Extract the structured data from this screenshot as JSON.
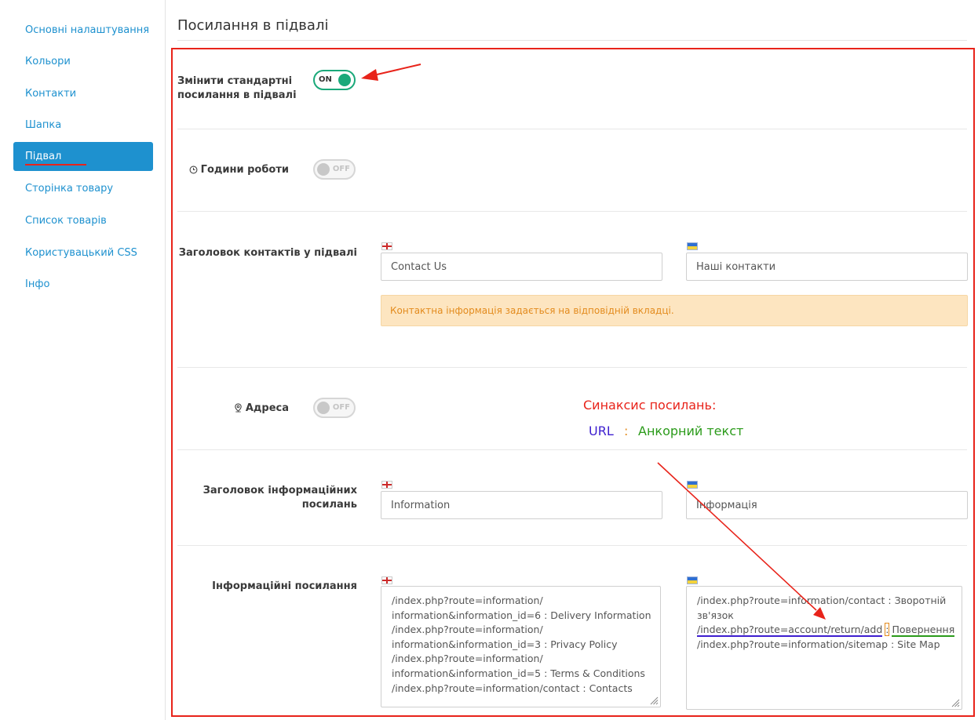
{
  "sidebar": {
    "items": [
      {
        "label": "Основні налаштування"
      },
      {
        "label": "Кольори"
      },
      {
        "label": "Контакти"
      },
      {
        "label": "Шапка"
      },
      {
        "label": "Підвал"
      },
      {
        "label": "Сторінка товару"
      },
      {
        "label": "Список товарів"
      },
      {
        "label": "Користувацький CSS"
      },
      {
        "label": "Інфо"
      }
    ],
    "active": "Підвал"
  },
  "page": {
    "title": "Посилання в підвалі"
  },
  "settings": {
    "override_links": {
      "label_line1": "Змінити стандартні",
      "label_line2": "посилання в підвалі",
      "state": "ON"
    },
    "work_hours": {
      "label": "Години роботи",
      "icon": "clock-icon",
      "state": "OFF"
    },
    "contacts_heading": {
      "label": "Заголовок контактів у підвалі",
      "en_value": "Contact Us",
      "ua_value": "Наші контакти",
      "notice": "Контактна інформація задається на відповідній вкладці."
    },
    "address": {
      "label": "Адреса",
      "icon": "location-pin-icon",
      "state": "OFF"
    },
    "info_heading": {
      "label_line1": "Заголовок інформаційних",
      "label_line2": "посилань",
      "en_value": "Information",
      "ua_value": "Інформація"
    },
    "info_links": {
      "label": "Інформаційні посилання",
      "en_lines": [
        "/index.php?route=information/",
        "information&information_id=6 : Delivery Information",
        "/index.php?route=information/",
        "information&information_id=3 : Privacy Policy",
        "/index.php?route=information/",
        "information&information_id=5 : Terms & Conditions",
        "/index.php?route=information/contact : Contacts"
      ],
      "ua_lines": [
        "/index.php?route=information/contact : Зворотній",
        "зв'язок",
        "/index.php?route=account/return/add",
        "/index.php?route=information/sitemap : Site Map"
      ],
      "ua_highlight": {
        "url": "/index.php?route=account/return/add",
        "sep": ":",
        "anchor": "Повернення"
      }
    }
  },
  "syntax_hint": {
    "title": "Синаксис посилань:",
    "url": "URL",
    "separator": ":",
    "anchor": "Анкорний текст"
  },
  "colors": {
    "accent": "#1e91cf",
    "toggle_on": "#1aa97a",
    "annotation_red": "#e8231a",
    "url_blue": "#3d1ecf",
    "anchor_green": "#2b9b1a",
    "warning_text": "#e38b1d"
  }
}
